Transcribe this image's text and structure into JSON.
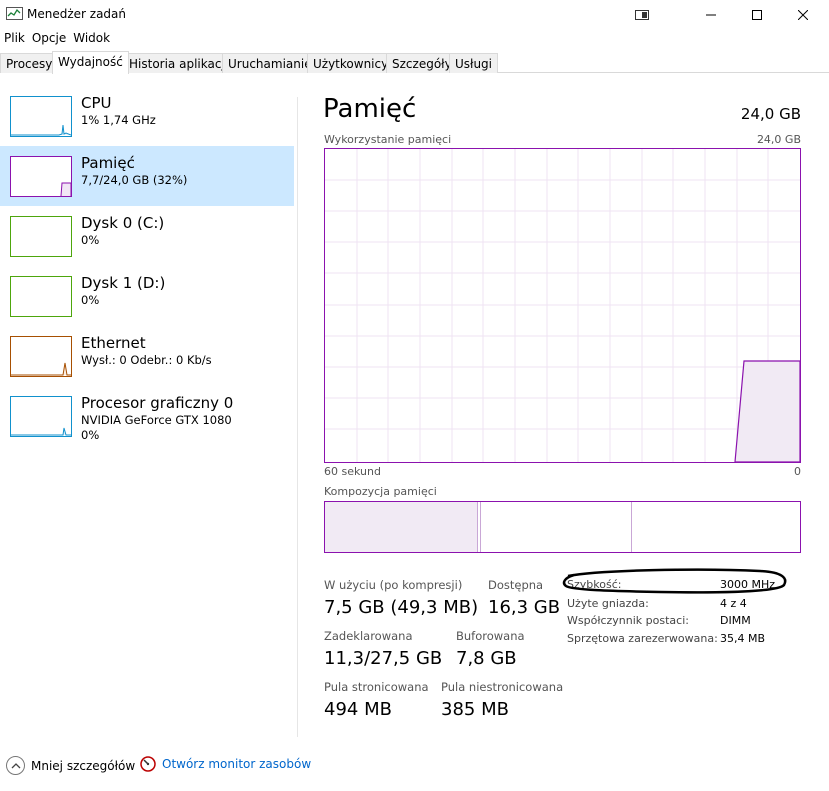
{
  "window": {
    "title": "Menedżer zadań"
  },
  "menu": [
    {
      "label": "Plik"
    },
    {
      "label": "Opcje"
    },
    {
      "label": "Widok"
    }
  ],
  "tabs": [
    {
      "label": "Procesy"
    },
    {
      "label": "Wydajność"
    },
    {
      "label": "Historia aplikacji"
    },
    {
      "label": "Uruchamianie"
    },
    {
      "label": "Użytkownicy"
    },
    {
      "label": "Szczegóły"
    },
    {
      "label": "Usługi"
    }
  ],
  "sidebar": [
    {
      "name": "CPU",
      "sub": "1% 1,74 GHz",
      "sub2": "",
      "color": "#1191cd"
    },
    {
      "name": "Pamięć",
      "sub": "7,7/24,0 GB (32%)",
      "sub2": "",
      "color": "#8b12ae"
    },
    {
      "name": "Dysk 0 (C:)",
      "sub": "0%",
      "sub2": "",
      "color": "#4da60c"
    },
    {
      "name": "Dysk 1 (D:)",
      "sub": "0%",
      "sub2": "",
      "color": "#4da60c"
    },
    {
      "name": "Ethernet",
      "sub": "Wysł.: 0 Odebr.: 0 Kb/s",
      "sub2": "",
      "color": "#a74f01"
    },
    {
      "name": "Procesor graficzny 0",
      "sub": "NVIDIA GeForce GTX 1080",
      "sub2": "0%",
      "color": "#1191cd"
    }
  ],
  "main": {
    "title": "Pamięć",
    "total": "24,0 GB",
    "graph_label": "Wykorzystanie pamięci",
    "graph_max": "24,0 GB",
    "graph_time": "60 sekund",
    "graph_zero": "0",
    "composition_label": "Kompozycja pamięci"
  },
  "stats": {
    "in_use_label": "W użyciu (po kompresji)",
    "in_use_value": "7,5 GB (49,3 MB)",
    "available_label": "Dostępna",
    "available_value": "16,3 GB",
    "committed_label": "Zadeklarowana",
    "committed_value": "11,3/27,5 GB",
    "cached_label": "Buforowana",
    "cached_value": "7,8 GB",
    "paged_label": "Pula stronicowana",
    "paged_value": "494 MB",
    "nonpaged_label": "Pula niestronicowana",
    "nonpaged_value": "385 MB"
  },
  "specs": [
    {
      "label": "Szybkość:",
      "value": "3000 MHz"
    },
    {
      "label": "Użyte gniazda:",
      "value": "4 z 4"
    },
    {
      "label": "Współczynnik postaci:",
      "value": "DIMM"
    },
    {
      "label": "Sprzętowa zarezerwowana:",
      "value": "35,4 MB"
    }
  ],
  "bottom": {
    "fewer_details": "Mniej szczegółów",
    "resource_monitor": "Otwórz monitor zasobów"
  },
  "colors": {
    "memory": "#8b12ae",
    "selected_bg": "#cce8ff",
    "link": "#0066cc"
  }
}
